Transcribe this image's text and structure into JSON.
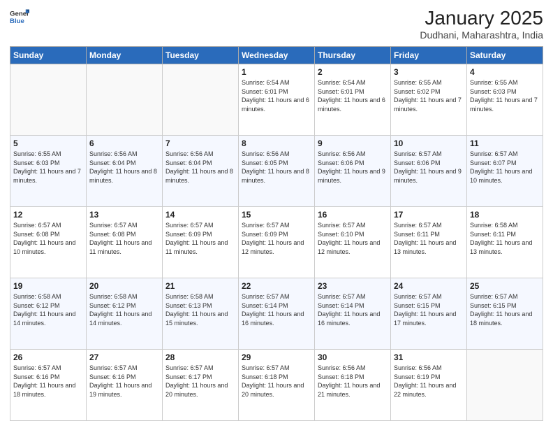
{
  "header": {
    "logo_line1": "General",
    "logo_line2": "Blue",
    "title": "January 2025",
    "subtitle": "Dudhani, Maharashtra, India"
  },
  "days_of_week": [
    "Sunday",
    "Monday",
    "Tuesday",
    "Wednesday",
    "Thursday",
    "Friday",
    "Saturday"
  ],
  "weeks": [
    [
      {
        "day": "",
        "info": ""
      },
      {
        "day": "",
        "info": ""
      },
      {
        "day": "",
        "info": ""
      },
      {
        "day": "1",
        "info": "Sunrise: 6:54 AM\nSunset: 6:01 PM\nDaylight: 11 hours\nand 6 minutes."
      },
      {
        "day": "2",
        "info": "Sunrise: 6:54 AM\nSunset: 6:01 PM\nDaylight: 11 hours\nand 6 minutes."
      },
      {
        "day": "3",
        "info": "Sunrise: 6:55 AM\nSunset: 6:02 PM\nDaylight: 11 hours\nand 7 minutes."
      },
      {
        "day": "4",
        "info": "Sunrise: 6:55 AM\nSunset: 6:03 PM\nDaylight: 11 hours\nand 7 minutes."
      }
    ],
    [
      {
        "day": "5",
        "info": "Sunrise: 6:55 AM\nSunset: 6:03 PM\nDaylight: 11 hours\nand 7 minutes."
      },
      {
        "day": "6",
        "info": "Sunrise: 6:56 AM\nSunset: 6:04 PM\nDaylight: 11 hours\nand 8 minutes."
      },
      {
        "day": "7",
        "info": "Sunrise: 6:56 AM\nSunset: 6:04 PM\nDaylight: 11 hours\nand 8 minutes."
      },
      {
        "day": "8",
        "info": "Sunrise: 6:56 AM\nSunset: 6:05 PM\nDaylight: 11 hours\nand 8 minutes."
      },
      {
        "day": "9",
        "info": "Sunrise: 6:56 AM\nSunset: 6:06 PM\nDaylight: 11 hours\nand 9 minutes."
      },
      {
        "day": "10",
        "info": "Sunrise: 6:57 AM\nSunset: 6:06 PM\nDaylight: 11 hours\nand 9 minutes."
      },
      {
        "day": "11",
        "info": "Sunrise: 6:57 AM\nSunset: 6:07 PM\nDaylight: 11 hours\nand 10 minutes."
      }
    ],
    [
      {
        "day": "12",
        "info": "Sunrise: 6:57 AM\nSunset: 6:08 PM\nDaylight: 11 hours\nand 10 minutes."
      },
      {
        "day": "13",
        "info": "Sunrise: 6:57 AM\nSunset: 6:08 PM\nDaylight: 11 hours\nand 11 minutes."
      },
      {
        "day": "14",
        "info": "Sunrise: 6:57 AM\nSunset: 6:09 PM\nDaylight: 11 hours\nand 11 minutes."
      },
      {
        "day": "15",
        "info": "Sunrise: 6:57 AM\nSunset: 6:09 PM\nDaylight: 11 hours\nand 12 minutes."
      },
      {
        "day": "16",
        "info": "Sunrise: 6:57 AM\nSunset: 6:10 PM\nDaylight: 11 hours\nand 12 minutes."
      },
      {
        "day": "17",
        "info": "Sunrise: 6:57 AM\nSunset: 6:11 PM\nDaylight: 11 hours\nand 13 minutes."
      },
      {
        "day": "18",
        "info": "Sunrise: 6:58 AM\nSunset: 6:11 PM\nDaylight: 11 hours\nand 13 minutes."
      }
    ],
    [
      {
        "day": "19",
        "info": "Sunrise: 6:58 AM\nSunset: 6:12 PM\nDaylight: 11 hours\nand 14 minutes."
      },
      {
        "day": "20",
        "info": "Sunrise: 6:58 AM\nSunset: 6:12 PM\nDaylight: 11 hours\nand 14 minutes."
      },
      {
        "day": "21",
        "info": "Sunrise: 6:58 AM\nSunset: 6:13 PM\nDaylight: 11 hours\nand 15 minutes."
      },
      {
        "day": "22",
        "info": "Sunrise: 6:57 AM\nSunset: 6:14 PM\nDaylight: 11 hours\nand 16 minutes."
      },
      {
        "day": "23",
        "info": "Sunrise: 6:57 AM\nSunset: 6:14 PM\nDaylight: 11 hours\nand 16 minutes."
      },
      {
        "day": "24",
        "info": "Sunrise: 6:57 AM\nSunset: 6:15 PM\nDaylight: 11 hours\nand 17 minutes."
      },
      {
        "day": "25",
        "info": "Sunrise: 6:57 AM\nSunset: 6:15 PM\nDaylight: 11 hours\nand 18 minutes."
      }
    ],
    [
      {
        "day": "26",
        "info": "Sunrise: 6:57 AM\nSunset: 6:16 PM\nDaylight: 11 hours\nand 18 minutes."
      },
      {
        "day": "27",
        "info": "Sunrise: 6:57 AM\nSunset: 6:16 PM\nDaylight: 11 hours\nand 19 minutes."
      },
      {
        "day": "28",
        "info": "Sunrise: 6:57 AM\nSunset: 6:17 PM\nDaylight: 11 hours\nand 20 minutes."
      },
      {
        "day": "29",
        "info": "Sunrise: 6:57 AM\nSunset: 6:18 PM\nDaylight: 11 hours\nand 20 minutes."
      },
      {
        "day": "30",
        "info": "Sunrise: 6:56 AM\nSunset: 6:18 PM\nDaylight: 11 hours\nand 21 minutes."
      },
      {
        "day": "31",
        "info": "Sunrise: 6:56 AM\nSunset: 6:19 PM\nDaylight: 11 hours\nand 22 minutes."
      },
      {
        "day": "",
        "info": ""
      }
    ]
  ],
  "accent_color": "#2a6bbb"
}
